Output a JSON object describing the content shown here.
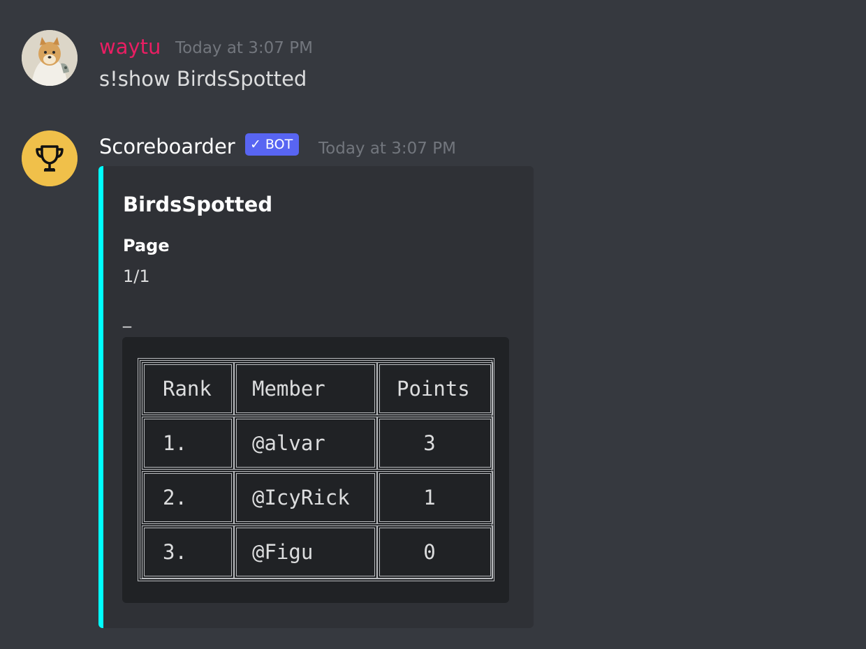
{
  "messages": [
    {
      "author": "waytu",
      "author_color": "#e91e63",
      "timestamp": "Today at 3:07 PM",
      "content": "s!show BirdsSpotted"
    },
    {
      "author": "Scoreboarder",
      "author_color": "#ffffff",
      "badge": "BOT",
      "badge_icon": "checkmark-icon",
      "timestamp": "Today at 3:07 PM",
      "avatar_icon": "trophy-icon",
      "avatar_color": "#f0c04a"
    }
  ],
  "embed": {
    "accent_color": "#00ffff",
    "title": "BirdsSpotted",
    "field_name": "Page",
    "field_value": "1/1",
    "separator": "_",
    "table": {
      "headers": [
        "Rank",
        "Member",
        "Points"
      ],
      "rows": [
        [
          "1.",
          "@alvar",
          "3"
        ],
        [
          "2.",
          "@IcyRick",
          "1"
        ],
        [
          "3.",
          "@Figu",
          "0"
        ]
      ]
    }
  }
}
